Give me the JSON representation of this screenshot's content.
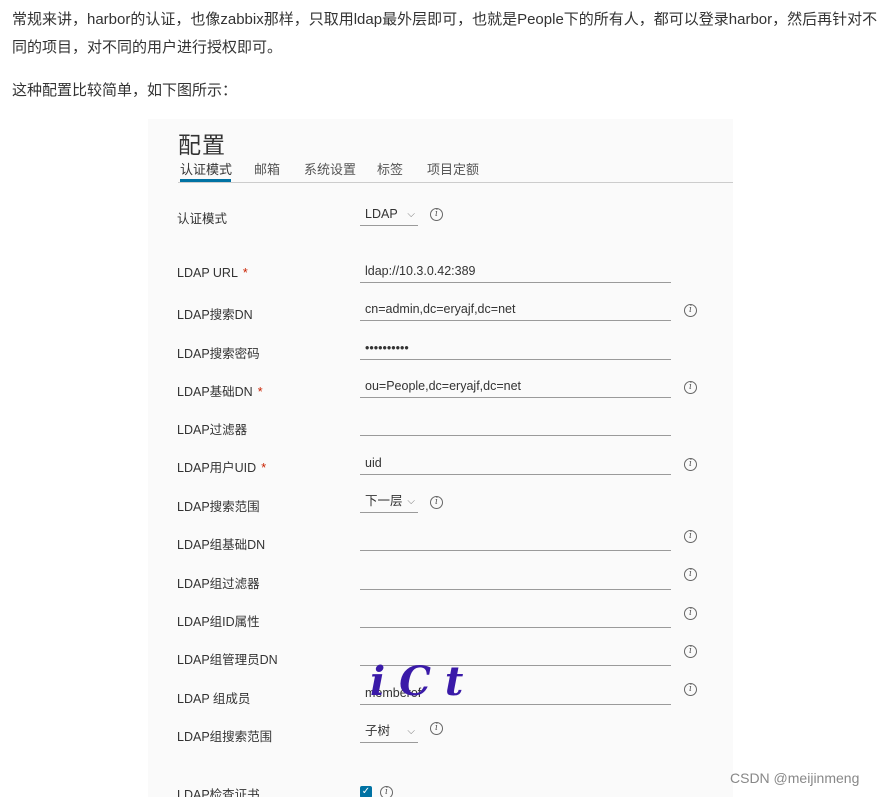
{
  "article": {
    "paragraph1": "常规来讲，harbor的认证，也像zabbix那样，只取用ldap最外层即可，也就是People下的所有人，都可以登录harbor，然后再针对不同的项目，对不同的用户进行授权即可。",
    "paragraph2": "这种配置比较简单，如下图所示："
  },
  "config": {
    "title": "配置",
    "tabs": [
      "认证模式",
      "邮箱",
      "系统设置",
      "标签",
      "项目定额"
    ],
    "active_tab": "认证模式",
    "fields": {
      "auth_mode_label": "认证模式",
      "auth_mode_value": "LDAP",
      "ldap_url_label": "LDAP URL",
      "ldap_url_value": "ldap://10.3.0.42:389",
      "search_dn_label": "LDAP搜索DN",
      "search_dn_value": "cn=admin,dc=eryajf,dc=net",
      "search_pwd_label": "LDAP搜索密码",
      "search_pwd_value": "••••••••••",
      "base_dn_label": "LDAP基础DN",
      "base_dn_value": "ou=People,dc=eryajf,dc=net",
      "filter_label": "LDAP过滤器",
      "filter_value": "",
      "uid_label": "LDAP用户UID",
      "uid_value": "uid",
      "scope_label": "LDAP搜索范围",
      "scope_value": "下一层",
      "group_base_dn_label": "LDAP组基础DN",
      "group_base_dn_value": "",
      "group_filter_label": "LDAP组过滤器",
      "group_filter_value": "",
      "group_id_attr_label": "LDAP组ID属性",
      "group_id_attr_value": "",
      "group_admin_dn_label": "LDAP组管理员DN",
      "group_admin_dn_value": "",
      "group_member_label": "LDAP 组成员",
      "group_member_value": "memberof",
      "group_scope_label": "LDAP组搜索范围",
      "group_scope_value": "子树",
      "verify_cert_label": "LDAP检查证书",
      "verify_cert_checked": true
    },
    "required_mark": "*"
  },
  "watermark": {
    "csdn": "CSDN @meijinmeng"
  },
  "colors": {
    "accent": "#0072a3",
    "required": "#c92100"
  }
}
